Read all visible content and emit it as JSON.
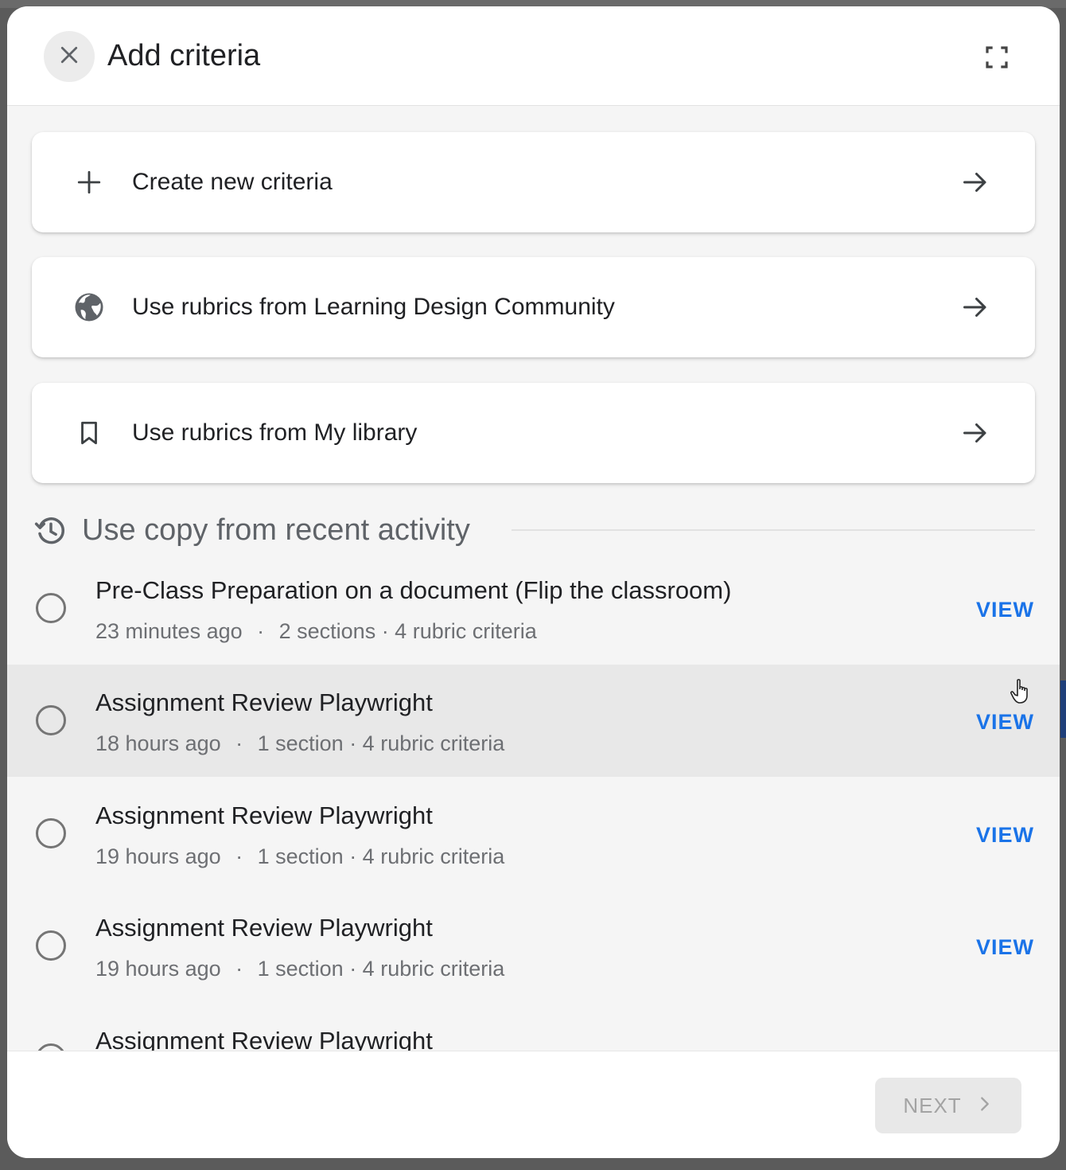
{
  "dialog": {
    "title": "Add criteria",
    "icons": {
      "close": "close-icon",
      "fullscreen": "fullscreen-icon"
    }
  },
  "options": [
    {
      "label": "Create new criteria",
      "icon": "plus-icon"
    },
    {
      "label": "Use rubrics from Learning Design Community",
      "icon": "globe-icon"
    },
    {
      "label": "Use rubrics from My library",
      "icon": "bookmark-icon"
    }
  ],
  "recent": {
    "title": "Use copy from recent activity",
    "icon": "history-icon",
    "view_label": "VIEW",
    "separator": "·",
    "items": [
      {
        "title": "Pre-Class Preparation on a document (Flip the classroom)",
        "time": "23 minutes ago",
        "details": "2 sections · 4 rubric criteria"
      },
      {
        "title": "Assignment Review Playwright",
        "time": "18 hours ago",
        "details": "1 section · 4 rubric criteria"
      },
      {
        "title": "Assignment Review Playwright",
        "time": "19 hours ago",
        "details": "1 section · 4 rubric criteria"
      },
      {
        "title": "Assignment Review Playwright",
        "time": "19 hours ago",
        "details": "1 section · 4 rubric criteria"
      },
      {
        "title": "Assignment Review Playwright",
        "time": "",
        "details": ""
      }
    ]
  },
  "footer": {
    "next_label": "NEXT"
  },
  "colors": {
    "accent": "#1a73e8",
    "text_primary": "#202124",
    "text_secondary": "#6d6f73",
    "hover_row": "#e8e8e8"
  }
}
